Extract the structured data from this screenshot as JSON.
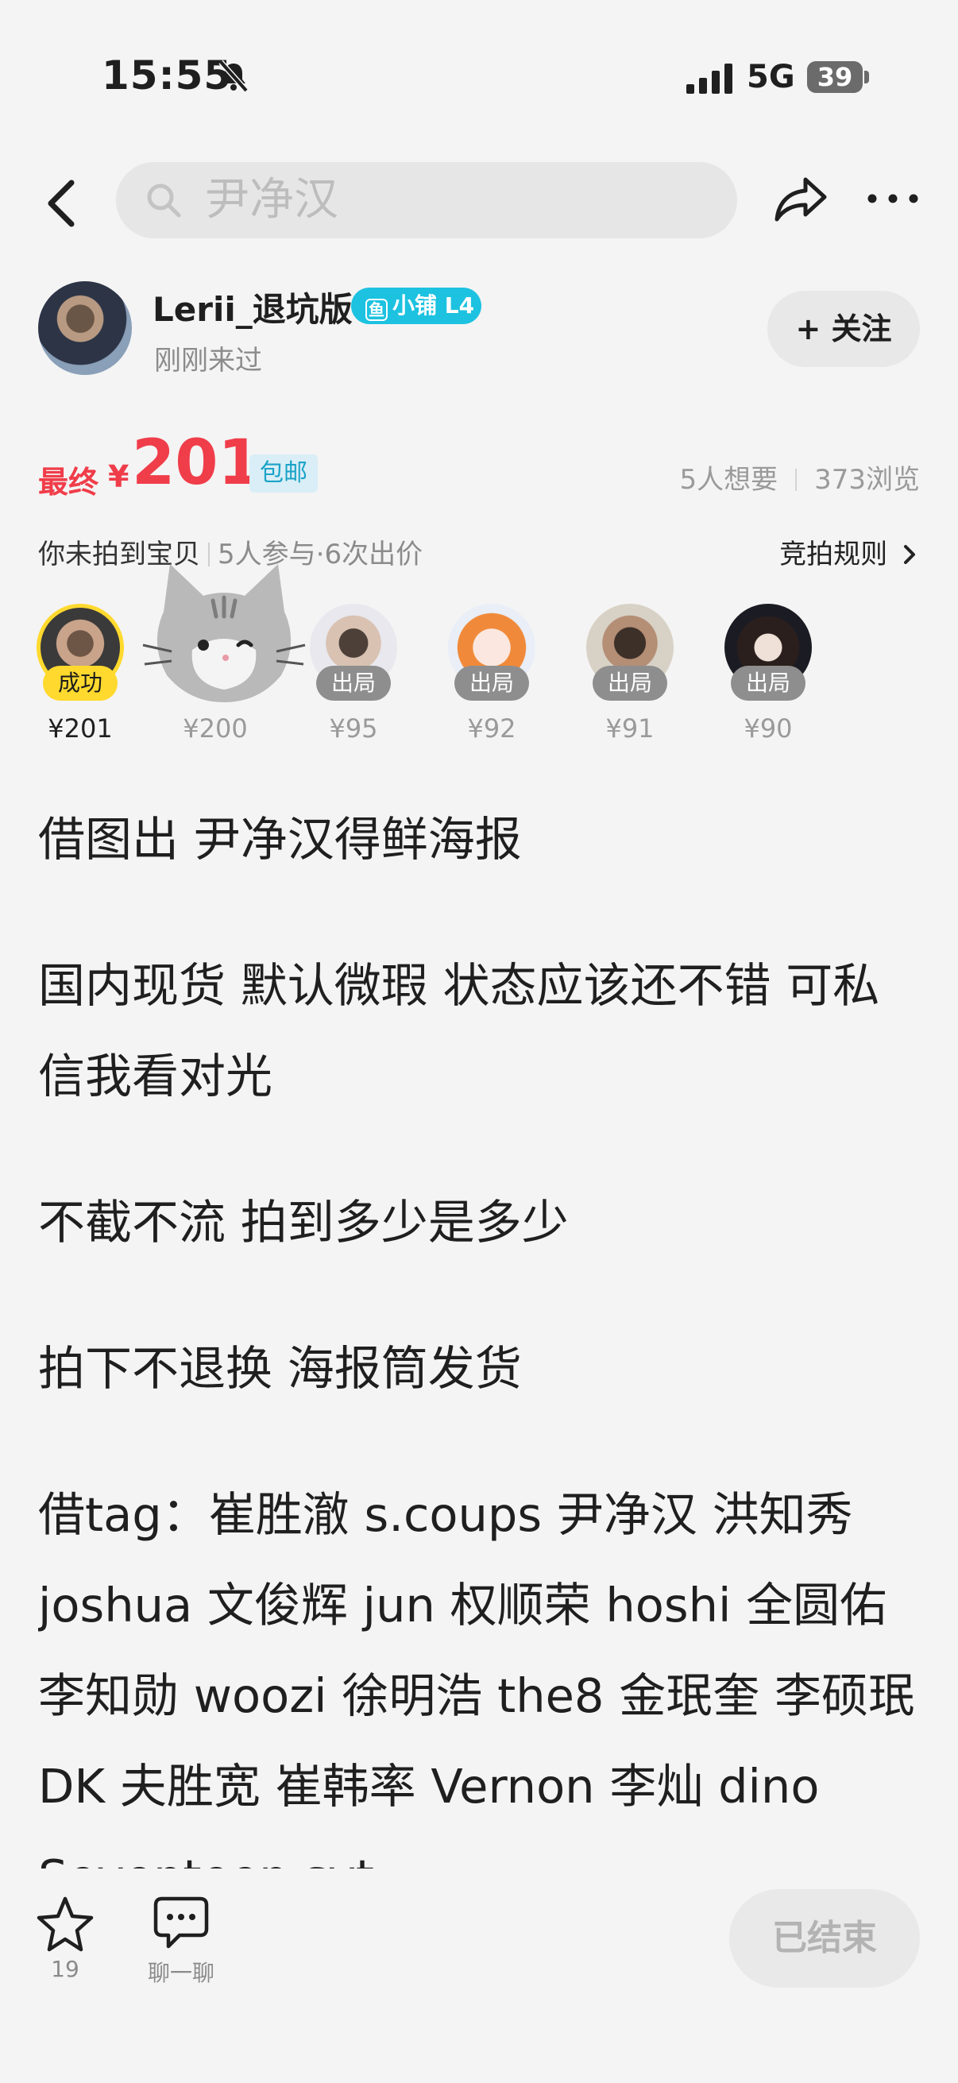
{
  "status_bar": {
    "time": "15:55",
    "network": "5G",
    "battery": "39"
  },
  "nav": {
    "search_text": "尹净汉"
  },
  "seller": {
    "name": "Lerii_退坑版",
    "badge": "小铺 L4",
    "badge_icon_text": "鱼",
    "last_seen": "刚刚来过"
  },
  "follow": {
    "label": "+ 关注"
  },
  "price": {
    "label": "最终",
    "currency": "¥",
    "value": "201",
    "shipping": "包邮"
  },
  "stats": {
    "wants": "5人想要",
    "views": "373浏览"
  },
  "auction": {
    "status": "你未拍到宝贝",
    "info": "5人参与·6次出价",
    "rules_label": "竞拍规则",
    "bidders": [
      {
        "tag": "成功",
        "amount": "¥201"
      },
      {
        "tag": "",
        "amount": "¥200"
      },
      {
        "tag": "出局",
        "amount": "¥95"
      },
      {
        "tag": "出局",
        "amount": "¥92"
      },
      {
        "tag": "出局",
        "amount": "¥91"
      },
      {
        "tag": "出局",
        "amount": "¥90"
      }
    ]
  },
  "description": {
    "p1": "借图出 尹净汉得鲜海报",
    "p2": "国内现货 默认微瑕 状态应该还不错 可私信我看对光",
    "p3": "不截不流 拍到多少是多少",
    "p4": "拍下不退换 海报筒发货",
    "p5": "借tag：崔胜澈 s.coups 尹净汉 洪知秀 joshua 文俊辉 jun 权顺荣 hoshi 全圆佑 李知勋 woozi 徐明浩 the8 金珉奎 李硕珉 DK 夫胜宽 崔韩率 Vernon 李灿 dino Seventeen svt"
  },
  "bottom_bar": {
    "fav_count": "19",
    "chat_label": "聊一聊",
    "ended_label": "已结束"
  },
  "colors": {
    "price_red": "#f03d4a",
    "badge_cyan": "#1cc2e0",
    "win_yellow": "#ffd92e"
  }
}
